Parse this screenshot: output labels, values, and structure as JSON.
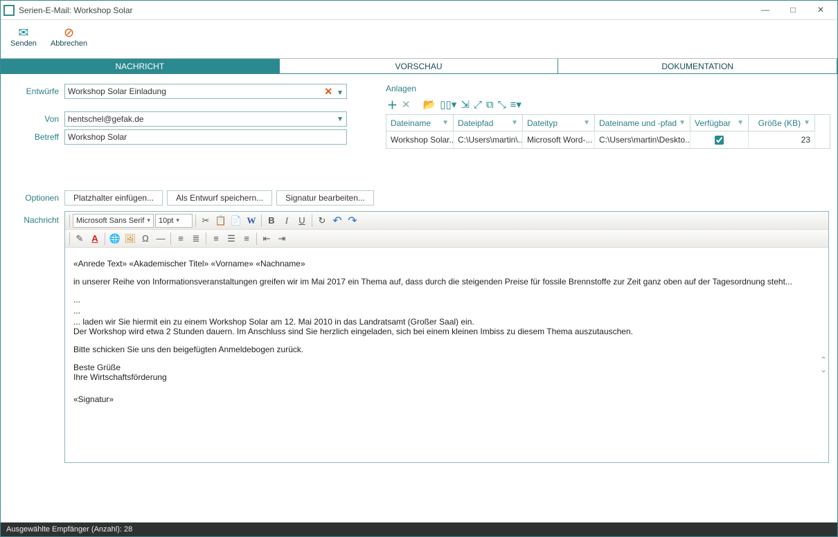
{
  "window": {
    "title": "Serien-E-Mail: Workshop Solar",
    "min": "—",
    "max": "□",
    "close": "✕"
  },
  "toolbar": {
    "send_label": "Senden",
    "cancel_label": "Abbrechen"
  },
  "tabs": {
    "msg": "NACHRICHT",
    "preview": "VORSCHAU",
    "doc": "DOKUMENTATION"
  },
  "form": {
    "drafts_label": "Entwürfe",
    "drafts_value": "Workshop Solar Einladung",
    "from_label": "Von",
    "from_value": "hentschel@gefak.de",
    "subject_label": "Betreff",
    "subject_value": "Workshop Solar"
  },
  "attachments": {
    "label": "Anlagen",
    "cols": {
      "name": "Dateiname",
      "path": "Dateipfad",
      "type": "Dateityp",
      "namepath": "Dateiname und -pfad",
      "avail": "Verfügbar",
      "size": "Größe (KB)"
    },
    "row": {
      "name": "Workshop Solar...",
      "path": "C:\\Users\\martin\\...",
      "type": "Microsoft Word-...",
      "namepath": "C:\\Users\\martin\\Deskto...",
      "avail": true,
      "size": "23"
    }
  },
  "options": {
    "label": "Optionen",
    "placeholder_btn": "Platzhalter einfügen...",
    "savedraft_btn": "Als Entwurf speichern...",
    "signature_btn": "Signatur bearbeiten..."
  },
  "message": {
    "label": "Nachricht",
    "font": "Microsoft Sans Serif",
    "size": "10pt",
    "body_line1": "«Anrede Text» «Akademischer Titel» «Vorname» «Nachname»",
    "body_line2": "in unserer Reihe von Informationsveranstaltungen greifen wir im Mai 2017 ein Thema auf, dass durch die steigenden Preise für fossile Brennstoffe zur Zeit ganz oben auf der Tagesordnung steht...",
    "body_line3": "...",
    "body_line4": "...",
    "body_line5": "... laden wir Sie hiermit ein zu einem Workshop Solar am 12. Mai 2010 in das Landratsamt (Großer Saal) ein.",
    "body_line6": "Der Workshop wird etwa 2 Stunden dauern. Im Anschluss sind Sie herzlich eingeladen, sich bei einem kleinen Imbiss zu diesem Thema auszutauschen.",
    "body_line7": "Bitte schicken Sie uns den beigefügten Anmeldebogen zurück.",
    "body_line8": "Beste Grüße",
    "body_line9": "Ihre Wirtschaftsförderung",
    "body_line10": "«Signatur»"
  },
  "status": {
    "text": "Ausgewählte Empfänger (Anzahl): 28"
  }
}
